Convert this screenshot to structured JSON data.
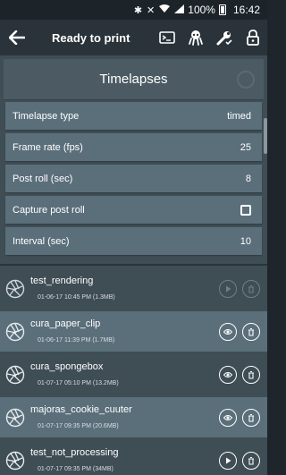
{
  "status_bar": {
    "icons": [
      "bluetooth-icon",
      "mute-icon",
      "wifi-icon",
      "signal-icon"
    ],
    "battery": "100%",
    "time": "16:42"
  },
  "app_bar": {
    "title": "Ready to print",
    "actions": [
      "terminal-icon",
      "octoprint-icon",
      "wrench-check-icon",
      "lock-icon"
    ]
  },
  "panel": {
    "title": "Timelapses",
    "settings": [
      {
        "label": "Timelapse type",
        "value": "timed"
      },
      {
        "label": "Frame rate (fps)",
        "value": "25"
      },
      {
        "label": "Post roll (sec)",
        "value": "8"
      },
      {
        "label": "Capture post roll",
        "checked": false
      },
      {
        "label": "Interval (sec)",
        "value": "10"
      }
    ]
  },
  "timelapses": [
    {
      "name": "test_rendering",
      "meta": "01-06-17 10:45 PM (1.3MB)",
      "actions": [
        "play-icon",
        "delete-icon"
      ],
      "enabled": false
    },
    {
      "name": "cura_paper_clip",
      "meta": "01-06-17 11:39 PM (1.7MB)",
      "actions": [
        "view-icon",
        "delete-icon"
      ],
      "enabled": true
    },
    {
      "name": "cura_spongebox",
      "meta": "01-07-17 05:10 PM (13.2MB)",
      "actions": [
        "view-icon",
        "delete-icon"
      ],
      "enabled": true
    },
    {
      "name": "majoras_cookie_cuuter",
      "meta": "01-07-17 09:35 PM (20.6MB)",
      "actions": [
        "view-icon",
        "delete-icon"
      ],
      "enabled": true
    },
    {
      "name": "test_not_processing",
      "meta": "01-07-17 09:35 PM (34MB)",
      "actions": [
        "play-icon",
        "delete-icon"
      ],
      "enabled": true
    }
  ],
  "colors": {
    "app_bar": "#2a333a",
    "panel": "#3f4d55",
    "row": "#5b6f7b"
  }
}
